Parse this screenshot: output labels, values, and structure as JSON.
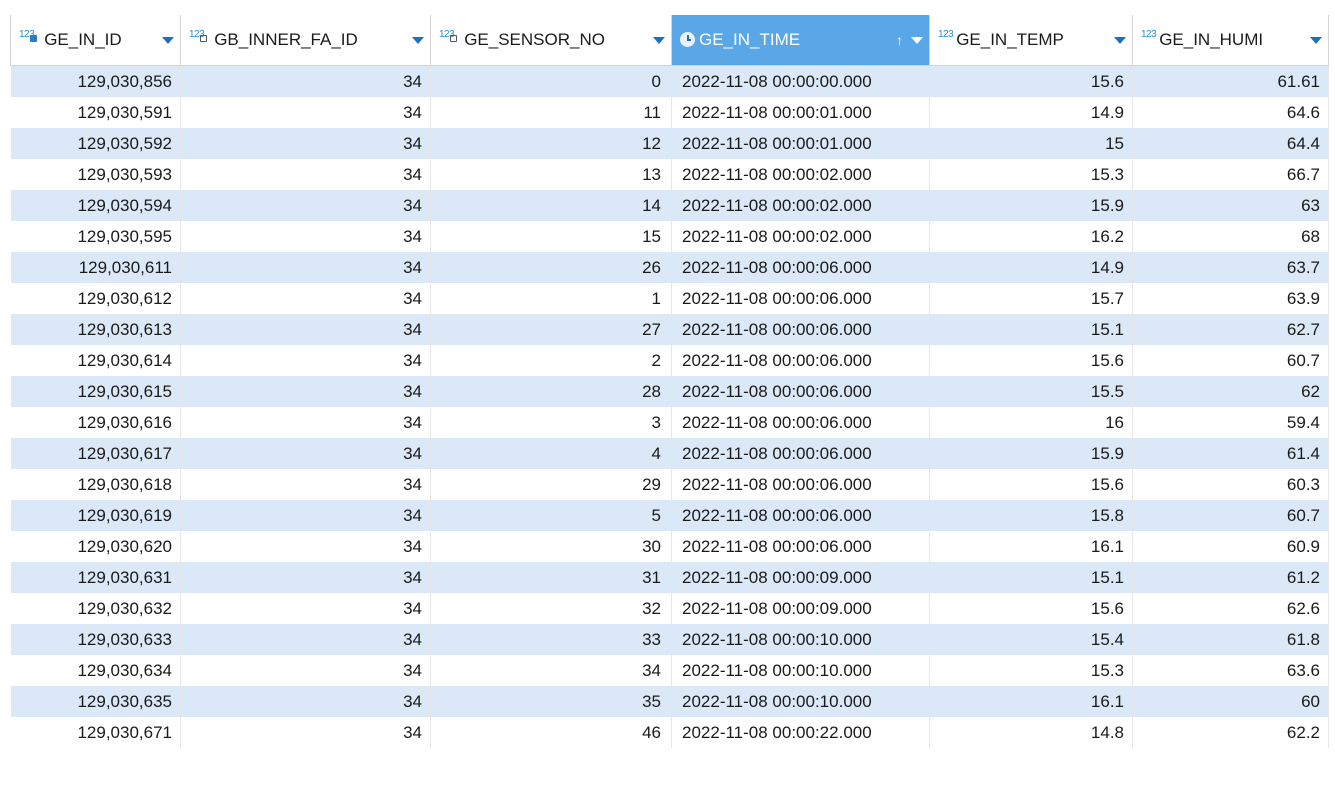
{
  "columns": [
    {
      "label": "GE_IN_ID",
      "type_icon": "123",
      "icon": "primary-key-number-icon"
    },
    {
      "label": "GB_INNER_FA_ID",
      "type_icon": "123",
      "icon": "foreign-key-number-icon"
    },
    {
      "label": "GE_SENSOR_NO",
      "type_icon": "123",
      "icon": "foreign-key-number-icon"
    },
    {
      "label": "GE_IN_TIME",
      "type_icon": "",
      "icon": "clock-icon",
      "sort": "ascending",
      "sort_glyph": "↑"
    },
    {
      "label": "GE_IN_TEMP",
      "type_icon": "123",
      "icon": "number-icon"
    },
    {
      "label": "GE_IN_HUMI",
      "type_icon": "123",
      "icon": "number-icon"
    }
  ],
  "rows": [
    [
      "129,030,856",
      "34",
      "0",
      "2022-11-08 00:00:00.000",
      "15.6",
      "61.61"
    ],
    [
      "129,030,591",
      "34",
      "11",
      "2022-11-08 00:00:01.000",
      "14.9",
      "64.6"
    ],
    [
      "129,030,592",
      "34",
      "12",
      "2022-11-08 00:00:01.000",
      "15",
      "64.4"
    ],
    [
      "129,030,593",
      "34",
      "13",
      "2022-11-08 00:00:02.000",
      "15.3",
      "66.7"
    ],
    [
      "129,030,594",
      "34",
      "14",
      "2022-11-08 00:00:02.000",
      "15.9",
      "63"
    ],
    [
      "129,030,595",
      "34",
      "15",
      "2022-11-08 00:00:02.000",
      "16.2",
      "68"
    ],
    [
      "129,030,611",
      "34",
      "26",
      "2022-11-08 00:00:06.000",
      "14.9",
      "63.7"
    ],
    [
      "129,030,612",
      "34",
      "1",
      "2022-11-08 00:00:06.000",
      "15.7",
      "63.9"
    ],
    [
      "129,030,613",
      "34",
      "27",
      "2022-11-08 00:00:06.000",
      "15.1",
      "62.7"
    ],
    [
      "129,030,614",
      "34",
      "2",
      "2022-11-08 00:00:06.000",
      "15.6",
      "60.7"
    ],
    [
      "129,030,615",
      "34",
      "28",
      "2022-11-08 00:00:06.000",
      "15.5",
      "62"
    ],
    [
      "129,030,616",
      "34",
      "3",
      "2022-11-08 00:00:06.000",
      "16",
      "59.4"
    ],
    [
      "129,030,617",
      "34",
      "4",
      "2022-11-08 00:00:06.000",
      "15.9",
      "61.4"
    ],
    [
      "129,030,618",
      "34",
      "29",
      "2022-11-08 00:00:06.000",
      "15.6",
      "60.3"
    ],
    [
      "129,030,619",
      "34",
      "5",
      "2022-11-08 00:00:06.000",
      "15.8",
      "60.7"
    ],
    [
      "129,030,620",
      "34",
      "30",
      "2022-11-08 00:00:06.000",
      "16.1",
      "60.9"
    ],
    [
      "129,030,631",
      "34",
      "31",
      "2022-11-08 00:00:09.000",
      "15.1",
      "61.2"
    ],
    [
      "129,030,632",
      "34",
      "32",
      "2022-11-08 00:00:09.000",
      "15.6",
      "62.6"
    ],
    [
      "129,030,633",
      "34",
      "33",
      "2022-11-08 00:00:10.000",
      "15.4",
      "61.8"
    ],
    [
      "129,030,634",
      "34",
      "34",
      "2022-11-08 00:00:10.000",
      "15.3",
      "63.6"
    ],
    [
      "129,030,635",
      "34",
      "35",
      "2022-11-08 00:00:10.000",
      "16.1",
      "60"
    ],
    [
      "129,030,671",
      "34",
      "46",
      "2022-11-08 00:00:22.000",
      "14.8",
      "62.2"
    ]
  ],
  "colors": {
    "sorted_header_bg": "#5aa7e8",
    "odd_row_bg": "#dbe8f8",
    "even_row_bg": "#ffffff",
    "type_icon": "#1f8fd6"
  }
}
